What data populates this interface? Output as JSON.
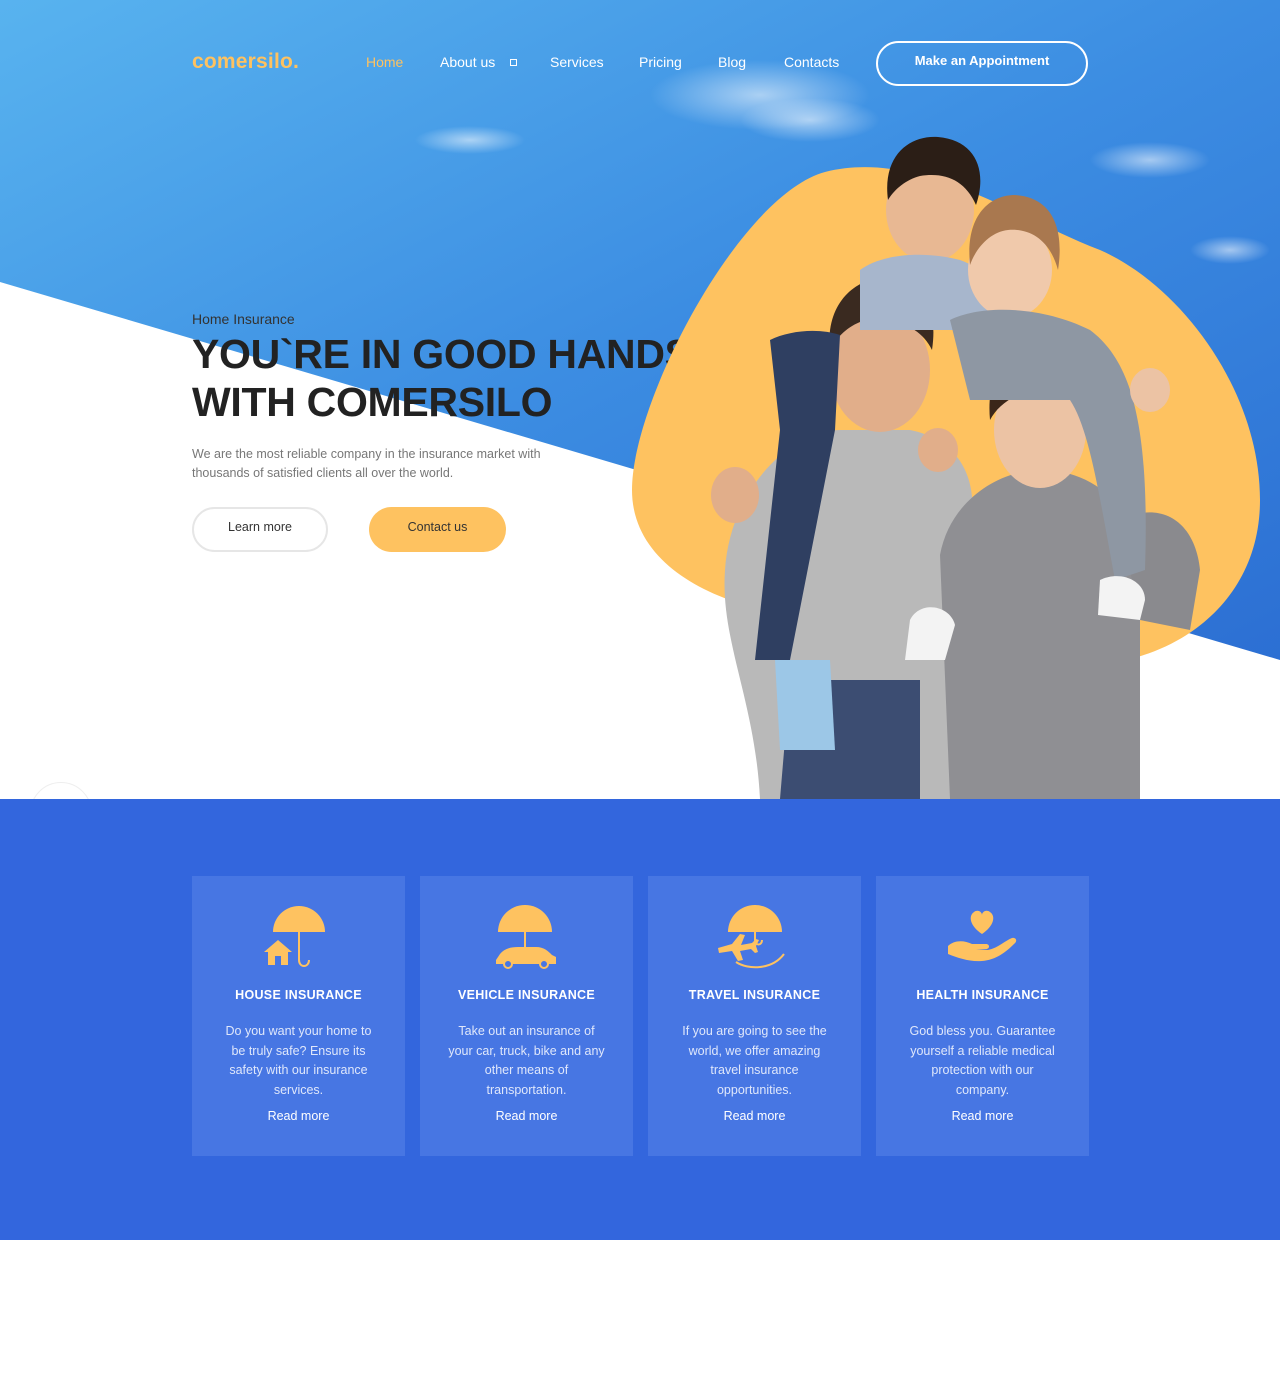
{
  "brand": {
    "logo": "comersilo."
  },
  "nav": {
    "items": [
      {
        "label": "Home",
        "active": true
      },
      {
        "label": "About us",
        "has_dropdown": true
      },
      {
        "label": "Services"
      },
      {
        "label": "Pricing"
      },
      {
        "label": "Blog"
      },
      {
        "label": "Contacts"
      }
    ],
    "cta": "Make an Appointment"
  },
  "hero": {
    "eyebrow": "Home Insurance",
    "title_line1": "YOU`RE IN GOOD HANDS",
    "title_line2": "WITH COMERSILO",
    "description_line1": "We are the most reliable company in the insurance market with",
    "description_line2": "thousands of satisfied clients all over the world.",
    "buttons": {
      "learn": "Learn more",
      "contact": "Contact us"
    }
  },
  "services": [
    {
      "title": "HOUSE INSURANCE",
      "description": "Do you want your home to be truly safe? Ensure its safety with our insurance services.",
      "link": "Read more",
      "icon": "house-umbrella-icon"
    },
    {
      "title": "VEHICLE INSURANCE",
      "description": "Take out an insurance of your car, truck, bike and any other means of transportation.",
      "link": "Read more",
      "icon": "car-umbrella-icon"
    },
    {
      "title": "TRAVEL INSURANCE",
      "description": "If you are going to see the world, we offer amazing travel insurance opportunities.",
      "link": "Read more",
      "icon": "plane-umbrella-icon"
    },
    {
      "title": "HEALTH INSURANCE",
      "description": "God bless you. Guarantee yourself a reliable medical protection with our company.",
      "link": "Read more",
      "icon": "heart-hand-icon"
    }
  ],
  "colors": {
    "accent": "#fec260",
    "services_bg": "#3366dd",
    "card_bg": "#4776e3",
    "sky_top": "#4aa8ec",
    "sky_bottom": "#2f74d6"
  }
}
